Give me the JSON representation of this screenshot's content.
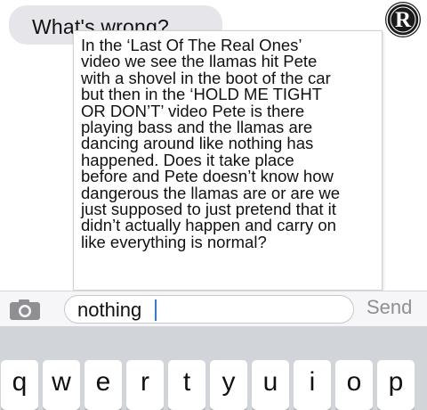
{
  "conversation": {
    "received_message": "What's wrong?",
    "overlay_text": "In the ‘Last Of The Real Ones’\nvideo we see the llamas hit Pete\nwith a shovel in the boot of the car\nbut then in the ‘HOLD ME TIGHT\nOR DON’T’ video Pete is there\nplaying bass and the llamas are\ndancing around like nothing has\nhappened. Does it take place\nbefore and Pete doesn’t know how\ndangerous the llamas are or are we\njust supposed to just pretend that it\ndidn’t actually happen and carry on\nlike everything is normal?"
  },
  "logo": {
    "letter": "R",
    "color": "#1b1b1b"
  },
  "input_bar": {
    "value": "nothing",
    "send_label": "Send",
    "clear_glyph": "×",
    "caret_color": "#2a7ae2",
    "send_color": "#8e8e93"
  },
  "keyboard": {
    "row1": [
      "q",
      "w",
      "e",
      "r",
      "t",
      "y",
      "u",
      "i",
      "o",
      "p"
    ]
  },
  "icons": [
    "camera-icon",
    "clear-icon",
    "logo-badge-icon"
  ]
}
